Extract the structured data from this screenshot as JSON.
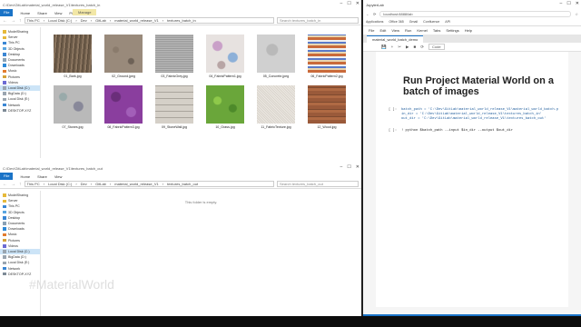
{
  "explorer_top": {
    "title": "C:\\Dev\\GitLab\\material_world_release_V1\\textures_batch_in",
    "manage": "Manage",
    "tabs": [
      "File",
      "Home",
      "Share",
      "View",
      "Picture Tools"
    ],
    "path": [
      "This PC",
      "Local Disk (C:)",
      "Dev",
      "GitLab",
      "material_world_release_V1",
      "textures_batch_in"
    ],
    "search": "Search textures_batch_in",
    "files": [
      {
        "name": "01_Bark.jpg",
        "pattern": "bark"
      },
      {
        "name": "02_Ground.jpeg",
        "pattern": "ground"
      },
      {
        "name": "03_FabricGrey.jpg",
        "pattern": "fabricgrey"
      },
      {
        "name": "04_FabricPattern1.jpg",
        "pattern": "fabricpattern1"
      },
      {
        "name": "05_Concrete.jpeg",
        "pattern": "concrete"
      },
      {
        "name": "06_FabricPattern2.jpg",
        "pattern": "fabricpattern2"
      },
      {
        "name": "07_Stones.jpg",
        "pattern": "stones"
      },
      {
        "name": "08_FabricPattern3.jpg",
        "pattern": "fabricpattern3"
      },
      {
        "name": "09_StoneWall.jpg",
        "pattern": "stonewall"
      },
      {
        "name": "10_Grass.jpg",
        "pattern": "grass"
      },
      {
        "name": "11_FabricTexture.jpg",
        "pattern": "fabrictexture"
      },
      {
        "name": "12_Wood.jpg",
        "pattern": "wood"
      }
    ]
  },
  "explorer_bottom": {
    "title": "C:\\Dev\\GitLab\\material_world_release_V1\\textures_batch_out",
    "tabs": [
      "File",
      "Home",
      "Share",
      "View"
    ],
    "path": [
      "This PC",
      "Local Disk (C:)",
      "Dev",
      "GitLab",
      "material_world_release_V1",
      "textures_batch_out"
    ],
    "search": "Search textures_batch_out",
    "empty_message": "This folder is empty."
  },
  "nav": [
    "ModelSharing",
    "Server",
    "This PC",
    "3D Objects",
    "Desktop",
    "Documents",
    "Downloads",
    "Music",
    "Pictures",
    "Videos",
    "Local Disk (C:)",
    "BigData (D:)",
    "Local Disk (E:)",
    "Network",
    "DESKTOP-XYZ"
  ],
  "jupyter": {
    "title": "JupyterLab",
    "url": "localhost:8888/lab",
    "bookmarks": [
      "Applications",
      "Office 365",
      "Gmail",
      "Confluence",
      "API"
    ],
    "menu": [
      "File",
      "Edit",
      "View",
      "Run",
      "Kernel",
      "Tabs",
      "Settings",
      "Help"
    ],
    "tab": "material_world_batch_demo",
    "cell_kind": "Code",
    "heading": "Run Project Material World on a batch of images",
    "code_lines": [
      "batch_path = 'C:\\Dev\\GitLab\\material_world_release_V1\\material_world_batch.p",
      "in_dir = 'C:\\Dev\\GitLab\\material_world_release_V1\\textures_batch_in'",
      "out_dir = 'C:\\Dev\\GitLab\\material_world_release_V1\\textures_batch_out'"
    ],
    "prompt1": "[ ]:",
    "prompt2": "[ ]:",
    "cmd": "! python $batch_path --input $in_dir --output $out_dir",
    "status": [
      "Python 3 | Idle",
      "Saving complete",
      "Mode: Command",
      "Ln 1, Col 1",
      "material_world_batch_demo"
    ]
  },
  "watermark": "#MaterialWorld"
}
